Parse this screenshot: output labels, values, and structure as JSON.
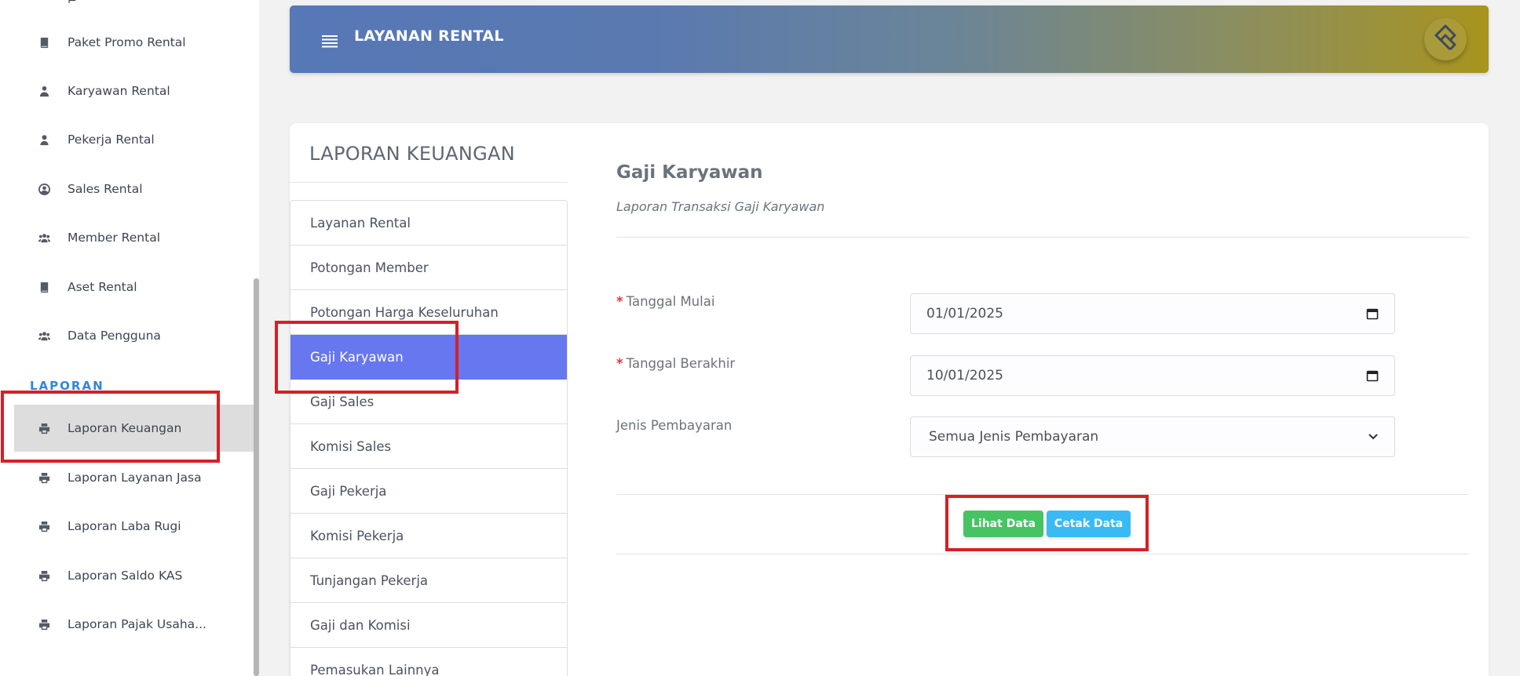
{
  "sidebar": {
    "items": [
      {
        "label": "Paket Promo Rental",
        "icon": "book-icon"
      },
      {
        "label": "Karyawan Rental",
        "icon": "user-tie-icon"
      },
      {
        "label": "Pekerja Rental",
        "icon": "user-icon"
      },
      {
        "label": "Sales Rental",
        "icon": "user-circle-icon"
      },
      {
        "label": "Member Rental",
        "icon": "users-icon"
      },
      {
        "label": "Aset Rental",
        "icon": "book-icon"
      },
      {
        "label": "Data Pengguna",
        "icon": "users-icon"
      }
    ],
    "section_heading": "LAPORAN",
    "report_items": [
      {
        "label": "Laporan Keuangan",
        "icon": "print-icon",
        "active": true
      },
      {
        "label": "Laporan Layanan Jasa",
        "icon": "print-icon"
      },
      {
        "label": "Laporan Laba Rugi",
        "icon": "print-icon"
      },
      {
        "label": "Laporan Saldo KAS",
        "icon": "print-icon"
      },
      {
        "label": "Laporan Pajak Usaha...",
        "icon": "print-icon"
      }
    ]
  },
  "header": {
    "title": "LAYANAN RENTAL",
    "menu_icon": "hamburger-icon",
    "logo_icon": "brand-logo-icon",
    "gradient_start": "#5678b6",
    "gradient_end": "#a8941d"
  },
  "card": {
    "title": "LAPORAN KEUANGAN",
    "report_list": [
      "Layanan Rental",
      "Potongan Member",
      "Potongan Harga Keseluruhan",
      "Gaji Karyawan",
      "Gaji Sales",
      "Komisi Sales",
      "Gaji Pekerja",
      "Komisi Pekerja",
      "Tunjangan Pekerja",
      "Gaji dan Komisi",
      "Pemasukan Lainnya"
    ],
    "active_report": "Gaji Karyawan"
  },
  "form": {
    "title": "Gaji Karyawan",
    "subtitle": "Laporan Transaksi Gaji Karyawan",
    "required_mark": "*",
    "start_label": "Tanggal Mulai",
    "start_value": "01/01/2025",
    "end_label": "Tanggal Berakhir",
    "end_value": "10/01/2025",
    "payment_label": "Jenis Pembayaran",
    "payment_value": "Semua Jenis Pembayaran",
    "view_button": "Lihat Data",
    "print_button": "Cetak Data"
  },
  "colors": {
    "accent": "#6777ef",
    "success": "#47c363",
    "info": "#3abaf4",
    "section": "#2e86de",
    "annotation": "#d42026"
  }
}
